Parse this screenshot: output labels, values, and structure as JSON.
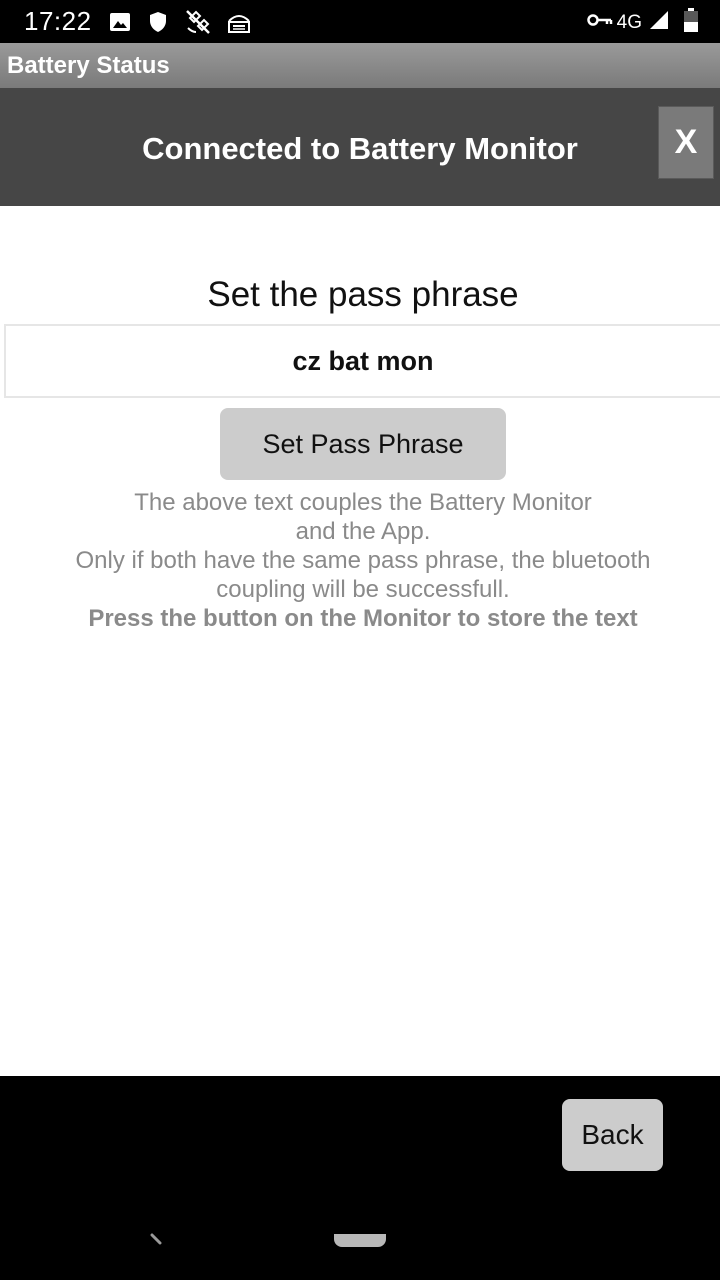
{
  "status_bar": {
    "time": "17:22",
    "network": "4G",
    "icons": [
      "image-icon",
      "shield-icon",
      "satellite-off-icon",
      "ethernet-icon",
      "vpn-key-icon",
      "signal-icon",
      "battery-icon"
    ]
  },
  "app_bar": {
    "title": "Battery Status"
  },
  "header": {
    "title": "Connected to Battery Monitor",
    "close_label": "X"
  },
  "passphrase": {
    "heading": "Set the pass phrase",
    "value": "cz bat mon",
    "button_label": "Set Pass Phrase"
  },
  "info": {
    "line1": "The above text couples the Battery Monitor",
    "line2": "and the App.",
    "line3": "Only if both have the same pass phrase, the bluetooth",
    "line4": "coupling will be successfull.",
    "line5": "Press the button on the Monitor to store the text"
  },
  "footer": {
    "back_label": "Back"
  },
  "colors": {
    "header_bg": "#464646",
    "titlebar_bg": "#8a8a8a",
    "button_bg": "#cccccc",
    "info_text": "#8a8a8a"
  }
}
